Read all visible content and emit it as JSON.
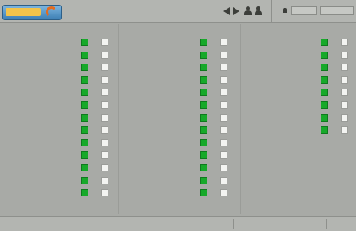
{
  "header": {
    "logo_text": "",
    "title_line1": "",
    "title_line2": "",
    "field1": "",
    "field2": ""
  },
  "columns": [
    {
      "header_label_a": "",
      "header_label_b": "",
      "rows": [
        {
          "label": "",
          "a": true,
          "b": false
        },
        {
          "label": "",
          "a": true,
          "b": false
        },
        {
          "label": "",
          "a": true,
          "b": false
        },
        {
          "label": "",
          "a": true,
          "b": false
        },
        {
          "label": "",
          "a": true,
          "b": false
        },
        {
          "label": "",
          "a": true,
          "b": false
        },
        {
          "label": "",
          "a": true,
          "b": false
        },
        {
          "label": "",
          "a": true,
          "b": false
        },
        {
          "label": "",
          "a": true,
          "b": false
        },
        {
          "label": "",
          "a": true,
          "b": false
        },
        {
          "label": "",
          "a": true,
          "b": false
        },
        {
          "label": "",
          "a": true,
          "b": false
        },
        {
          "label": "",
          "a": true,
          "b": false
        }
      ]
    },
    {
      "header_label_a": "",
      "header_label_b": "",
      "rows": [
        {
          "label": "",
          "a": true,
          "b": false
        },
        {
          "label": "",
          "a": true,
          "b": false
        },
        {
          "label": "",
          "a": true,
          "b": false
        },
        {
          "label": "",
          "a": true,
          "b": false
        },
        {
          "label": "",
          "a": true,
          "b": false
        },
        {
          "label": "",
          "a": true,
          "b": false
        },
        {
          "label": "",
          "a": true,
          "b": false
        },
        {
          "label": "",
          "a": true,
          "b": false
        },
        {
          "label": "",
          "a": true,
          "b": false
        },
        {
          "label": "",
          "a": true,
          "b": false
        },
        {
          "label": "",
          "a": true,
          "b": false
        },
        {
          "label": "",
          "a": true,
          "b": false
        },
        {
          "label": "",
          "a": true,
          "b": false
        }
      ]
    },
    {
      "header_label_a": "",
      "header_label_b": "",
      "rows": [
        {
          "label": "",
          "a": true,
          "b": false
        },
        {
          "label": "",
          "a": true,
          "b": false
        },
        {
          "label": "",
          "a": true,
          "b": false
        },
        {
          "label": "",
          "a": true,
          "b": false
        },
        {
          "label": "",
          "a": true,
          "b": false
        },
        {
          "label": "",
          "a": true,
          "b": false
        },
        {
          "label": "",
          "a": true,
          "b": false
        },
        {
          "label": "",
          "a": true,
          "b": false
        }
      ]
    }
  ],
  "status_bar": {
    "cell1": "",
    "cell2": "",
    "cell3": ""
  },
  "colors": {
    "checked": "#17a92a",
    "unchecked": "#f3f4f1",
    "panel": "#a8aaa6",
    "accent": "#3d7fb4"
  },
  "icons": [
    "prev-arrow-icon",
    "next-arrow-icon",
    "person-icon",
    "person-icon",
    "bell-icon"
  ]
}
